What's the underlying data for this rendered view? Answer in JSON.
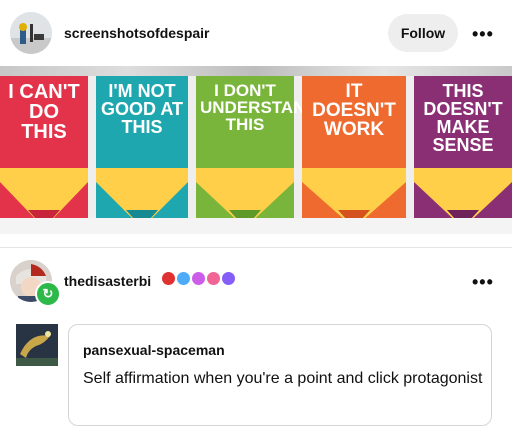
{
  "post": {
    "username": "screenshotsofdespair",
    "follow_label": "Follow",
    "more_label": "•••"
  },
  "banner": {
    "pencils": [
      {
        "text": "I CAN'T DO THIS",
        "color": "#e2334a",
        "tip": "#ffcf4a",
        "point": "#c8243b"
      },
      {
        "text": "I'M NOT GOOD AT THIS",
        "color": "#1fa7b0",
        "tip": "#ffcf4a",
        "point": "#158a93"
      },
      {
        "text": "I DON'T UNDERSTAND THIS",
        "color": "#79b53a",
        "tip": "#ffcf4a",
        "point": "#5e9a2a"
      },
      {
        "text": "IT DOESN'T WORK",
        "color": "#ef6a2f",
        "tip": "#ffcf4a",
        "point": "#d5521f"
      },
      {
        "text": "THIS DOESN'T MAKE SENSE",
        "color": "#8b2f74",
        "tip": "#ffcf4a",
        "point": "#6e215b"
      }
    ]
  },
  "reblog": {
    "reblogger": "thedisasterbi",
    "badge_icon": "reblog-icon",
    "more_label": "•••",
    "quote_author": "pansexual-spaceman",
    "quote_text": "Self affirmation when you're a point and click protagonist"
  },
  "colors": {
    "follow_bg": "#eeeeee",
    "reblog_badge": "#2db84a",
    "card_border": "#d5d5d5"
  }
}
